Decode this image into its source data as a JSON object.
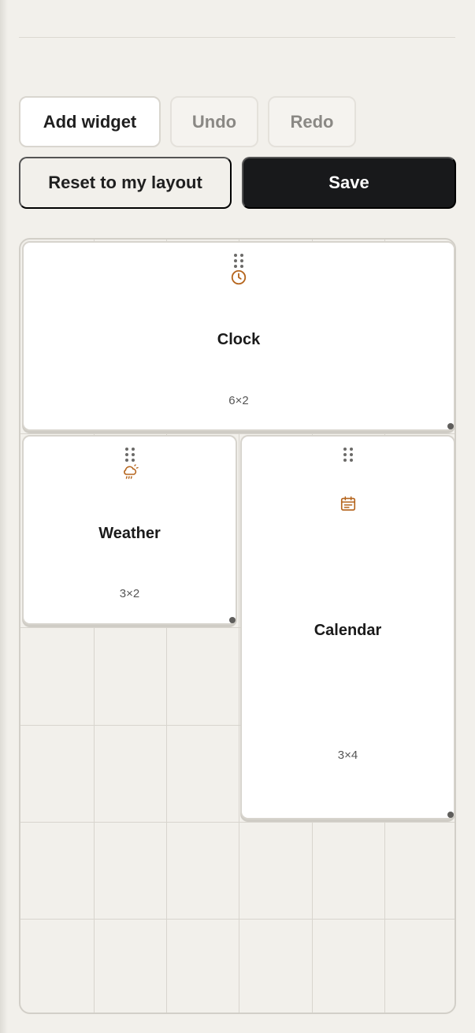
{
  "toolbar": {
    "add_widget_label": "Add widget",
    "undo_label": "Undo",
    "redo_label": "Redo",
    "reset_label": "Reset to my layout",
    "save_label": "Save"
  },
  "widgets": [
    {
      "title": "Clock",
      "size": "6×2",
      "icon": "clock-icon"
    },
    {
      "title": "Weather",
      "size": "3×2",
      "icon": "cloud-rain-icon"
    },
    {
      "title": "Calendar",
      "size": "3×4",
      "icon": "calendar-icon"
    }
  ],
  "colors": {
    "accent": "#b5651d",
    "save_bg": "#18191b",
    "background": "#f2f0eb"
  }
}
